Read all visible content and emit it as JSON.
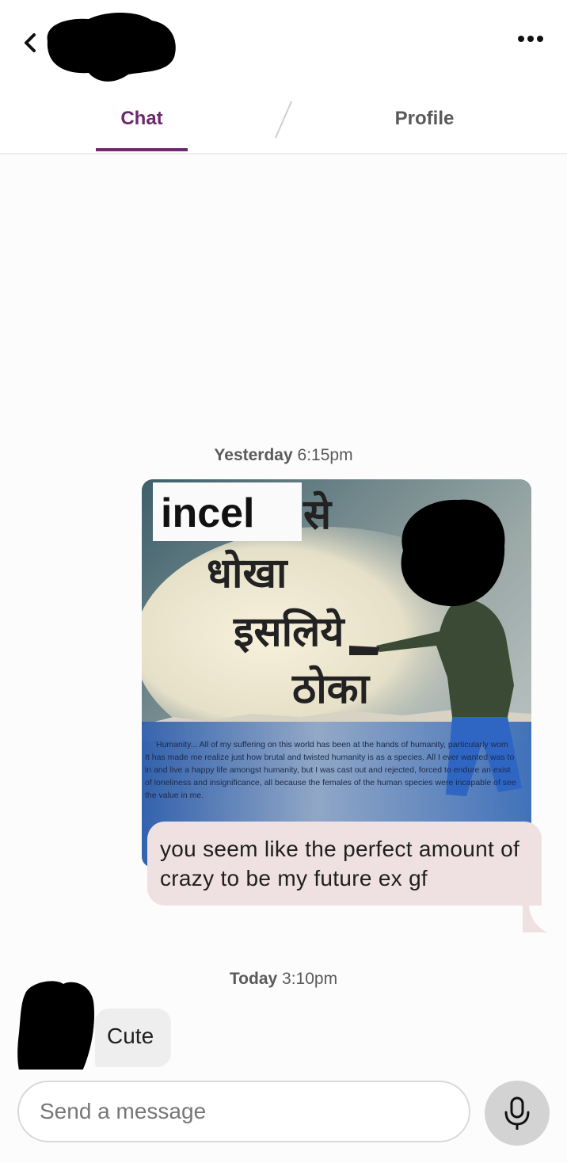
{
  "header": {
    "back_icon": "chevron-left-icon",
    "more_icon": "more-horizontal-icon"
  },
  "tabs": [
    {
      "label": "Chat",
      "active": true
    },
    {
      "label": "Profile",
      "active": false
    }
  ],
  "colors": {
    "accent": "#6b2a6b",
    "sent_bubble": "#efe1e1",
    "received_bubble": "#eeeeee",
    "mic_button": "#d3d3d3"
  },
  "messages": {
    "group1": {
      "day": "Yesterday",
      "time": "6:15pm",
      "image": {
        "overlay_title": "incel",
        "hindi_lines": [
          "से",
          "धोखा",
          "इसलिये",
          "ठोका"
        ],
        "caption_lines": [
          "Humanity... All of my suffering on this world has been at the hands of humanity, particularly wom",
          "It has made me realize just how brutal and twisted humanity is as a species. All I ever wanted was to",
          "in and live a happy life amongst humanity, but I was cast out and rejected, forced to endure an exist",
          "of loneliness and insignificance, all because the females of the human species were incapable of see",
          "the value in me."
        ]
      },
      "text": "you seem like the perfect amount of crazy to be my future ex gf"
    },
    "group2": {
      "day": "Today",
      "time": "3:10pm",
      "text": "Cute"
    }
  },
  "composer": {
    "placeholder": "Send a message",
    "mic_icon": "microphone-icon"
  }
}
